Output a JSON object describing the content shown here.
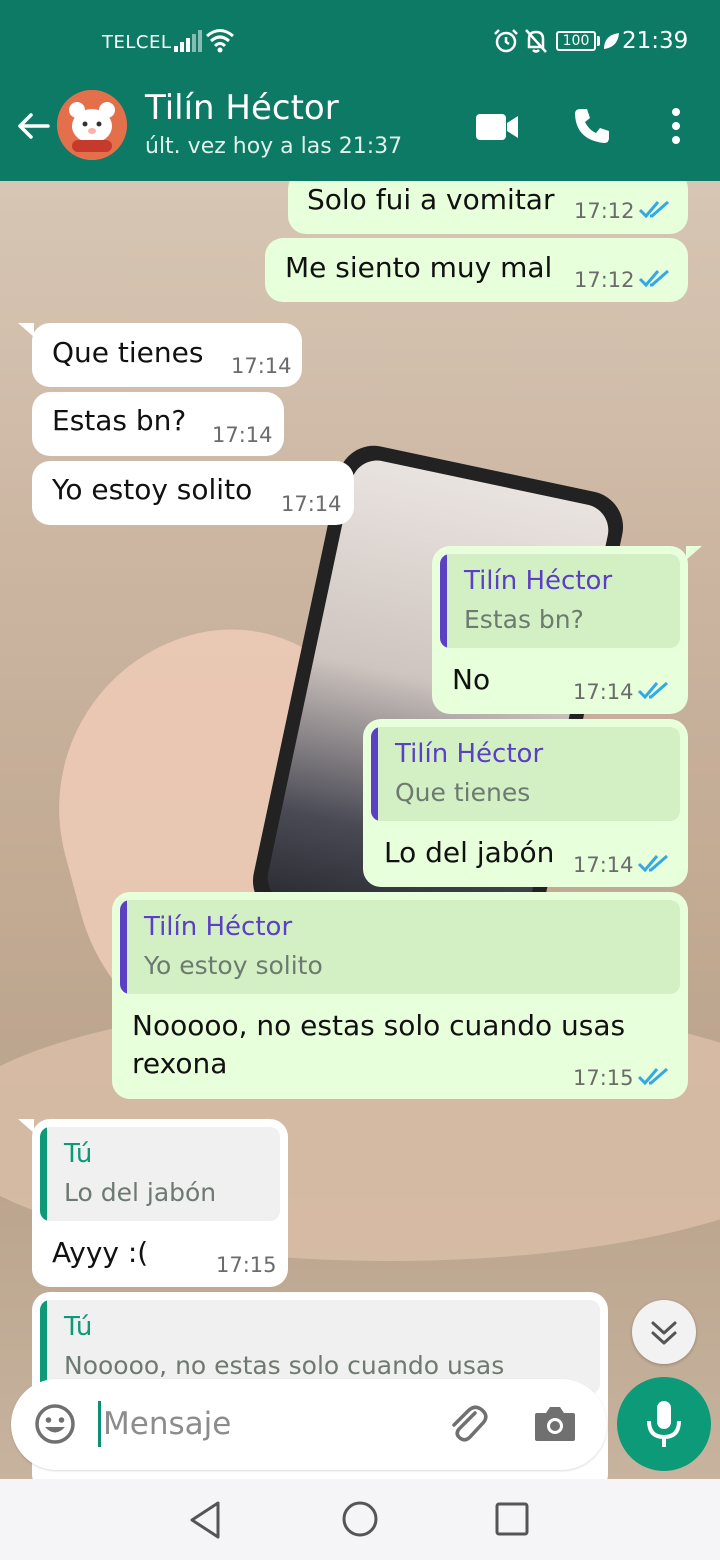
{
  "status_bar": {
    "carrier": "TELCEL",
    "battery": "100",
    "time": "21:39"
  },
  "header": {
    "contact_name": "Tilín Héctor",
    "last_seen": "últ. vez hoy a las 21:37"
  },
  "messages": [
    {
      "direction": "out",
      "text": "Solo fui a vomitar",
      "time": "17:12",
      "status": "read"
    },
    {
      "direction": "out",
      "text": "Me siento muy mal",
      "time": "17:12",
      "status": "read"
    },
    {
      "direction": "in",
      "text": "Que tienes",
      "time": "17:14"
    },
    {
      "direction": "in",
      "text": "Estas bn?",
      "time": "17:14"
    },
    {
      "direction": "in",
      "text": "Yo estoy solito",
      "time": "17:14"
    },
    {
      "direction": "out",
      "quote_author": "Tilín Héctor",
      "quote_text": "Estas bn?",
      "text": "No",
      "time": "17:14",
      "status": "read"
    },
    {
      "direction": "out",
      "quote_author": "Tilín Héctor",
      "quote_text": "Que tienes",
      "text": "Lo del jabón",
      "time": "17:14",
      "status": "read"
    },
    {
      "direction": "out",
      "quote_author": "Tilín Héctor",
      "quote_text": "Yo estoy solito",
      "text_line1": "Nooooo, no estas solo cuando usas",
      "text_line2": "rexona",
      "time": "17:15",
      "status": "read"
    },
    {
      "direction": "in",
      "quote_author": "Tú",
      "quote_text": "Lo del jabón",
      "text": "Ayyy :(",
      "time": "17:15"
    },
    {
      "direction": "in",
      "quote_author": "Tú",
      "quote_text": "Nooooo, no estas solo cuando usas"
    }
  ],
  "composer": {
    "placeholder": "Mensaje"
  },
  "colors": {
    "header": "#0c7a64",
    "outgoing_bubble": "#e7ffdb",
    "incoming_bubble": "#ffffff",
    "read_ticks": "#34a8e6",
    "quote_bar_contact": "#5b3fc4",
    "quote_bar_self": "#0c9a78",
    "mic_button": "#0c9a78"
  },
  "icons": [
    "signal-icon",
    "wifi-icon",
    "alarm-icon",
    "bell-off-icon",
    "leaf-icon",
    "back-arrow-icon",
    "video-call-icon",
    "voice-call-icon",
    "more-options-icon",
    "double-check-icon",
    "chevron-double-down-icon",
    "emoji-icon",
    "attach-icon",
    "camera-icon",
    "mic-icon",
    "nav-back-icon",
    "nav-home-icon",
    "nav-recents-icon"
  ]
}
